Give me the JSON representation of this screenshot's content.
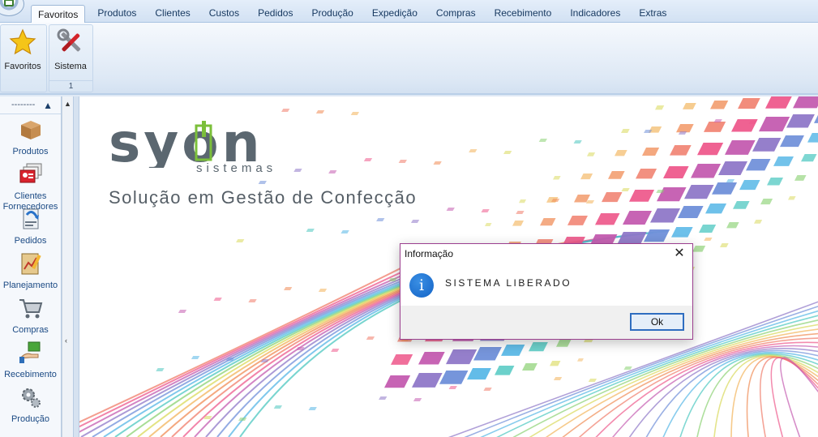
{
  "ribbon": {
    "tabs": [
      "Favoritos",
      "Produtos",
      "Clientes",
      "Custos",
      "Pedidos",
      "Produção",
      "Expedição",
      "Compras",
      "Recebimento",
      "Indicadores",
      "Extras"
    ],
    "active_tab": "Favoritos",
    "groups": [
      {
        "buttons": [
          {
            "label": "Favoritos",
            "icon": "star-icon"
          }
        ],
        "footer": ""
      },
      {
        "buttons": [
          {
            "label": "Sistema",
            "icon": "tools-icon"
          }
        ],
        "footer": "1"
      }
    ]
  },
  "nav": {
    "header": "--------",
    "items": [
      {
        "label": "Produtos",
        "icon": "box-icon"
      },
      {
        "label": "Clientes Fornecedores",
        "icon": "contacts-icon"
      },
      {
        "label": "Pedidos",
        "icon": "order-icon"
      },
      {
        "label": "Planejamento",
        "icon": "planning-icon"
      },
      {
        "label": "Compras",
        "icon": "cart-icon"
      },
      {
        "label": "Recebimento",
        "icon": "receive-icon"
      },
      {
        "label": "Produção",
        "icon": "gears-icon"
      }
    ]
  },
  "brand": {
    "name": "syon",
    "sub": "sistemas",
    "tagline": "Solução em Gestão de Confecção"
  },
  "dialog": {
    "title": "Informação",
    "message": "SISTEMA LIBERADO",
    "ok_label": "Ok",
    "close_symbol": "✕"
  },
  "colors": {
    "ribbon_blue": "#dfe9f5",
    "brand_green": "#7bbf3a",
    "dialog_border": "#9b3f8f",
    "info_blue": "#1a6fd0"
  }
}
